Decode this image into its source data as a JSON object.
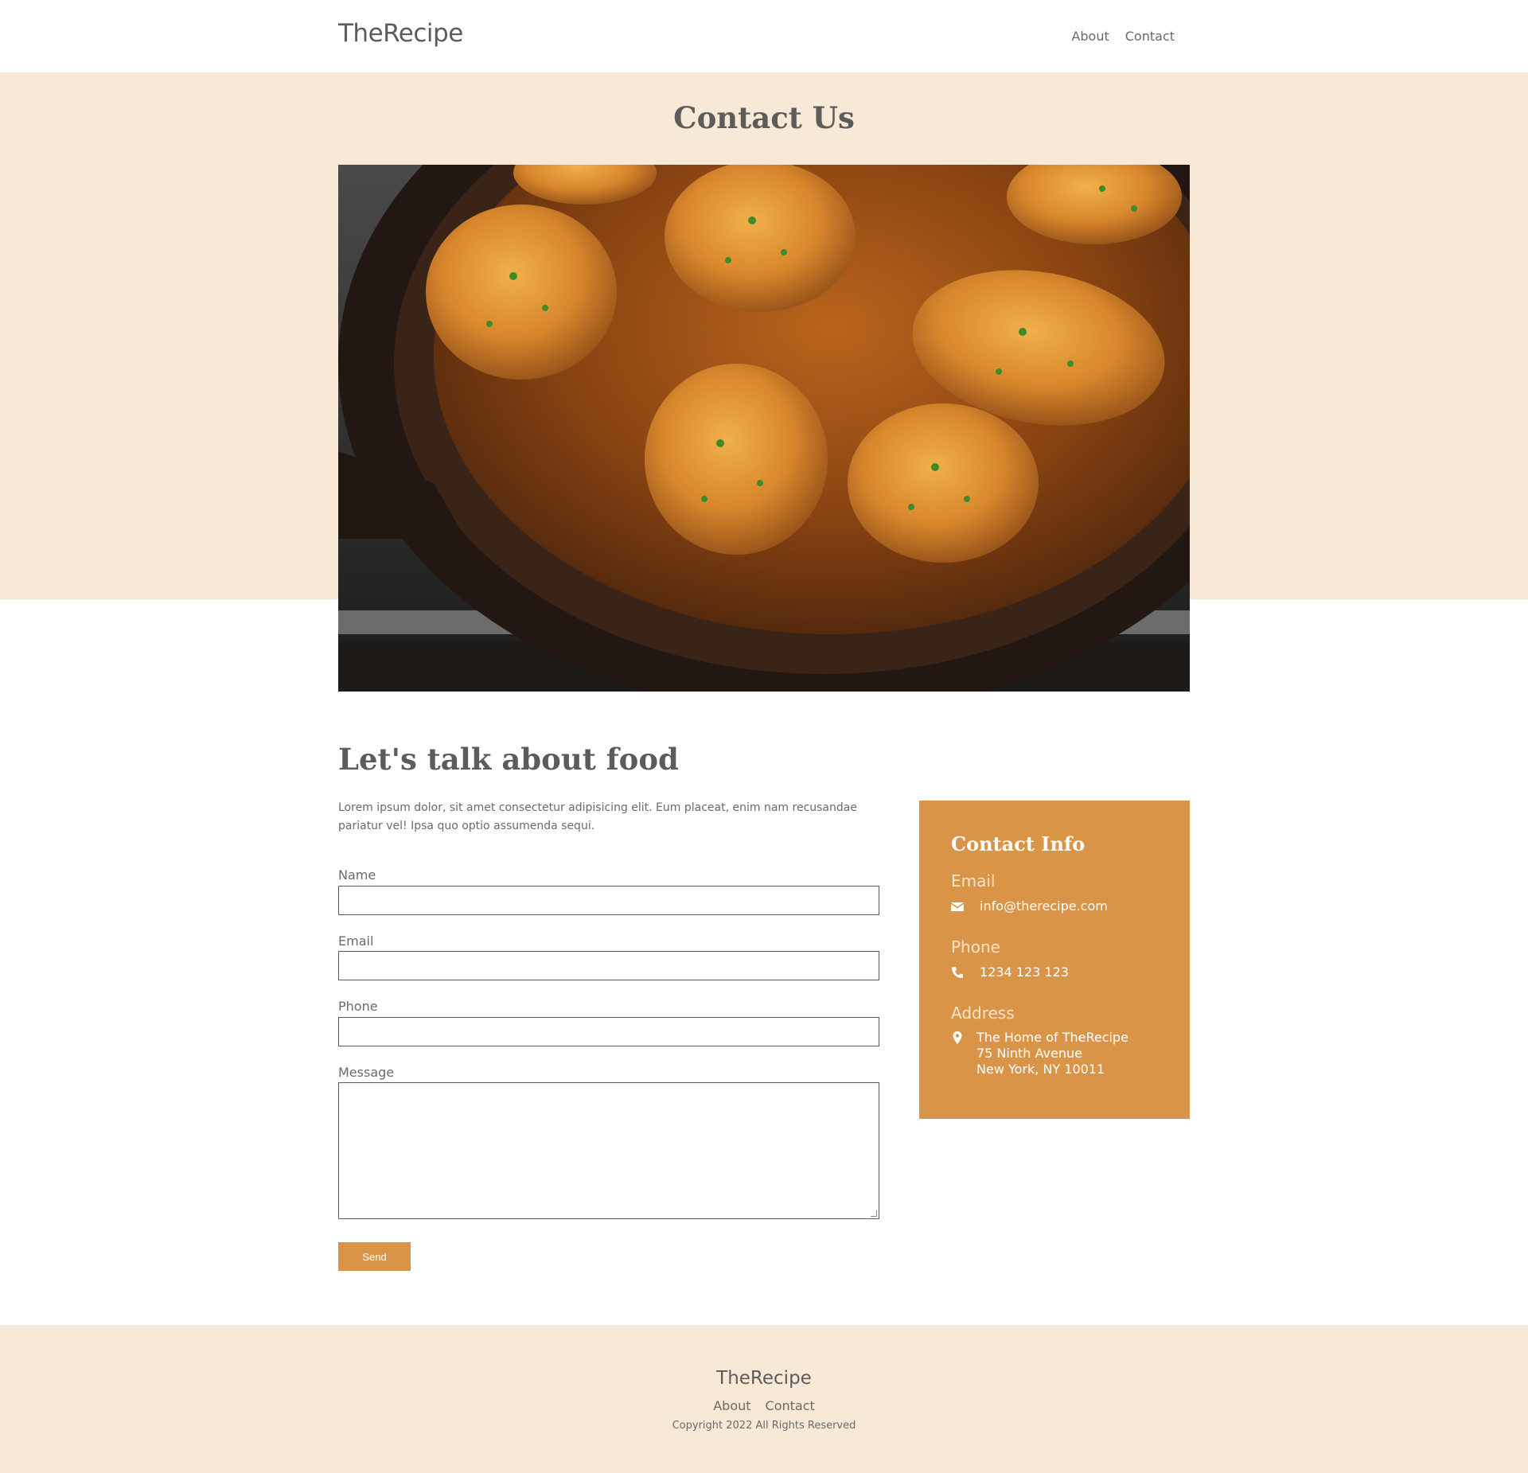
{
  "header": {
    "logo": "TheRecipe",
    "nav": [
      {
        "label": "About"
      },
      {
        "label": "Contact"
      }
    ]
  },
  "hero": {
    "title": "Contact Us",
    "image_alt": "chicken-thighs-in-cast-iron-skillet"
  },
  "content": {
    "heading": "Let's talk about food",
    "intro": "Lorem ipsum dolor, sit amet consectetur adipisicing elit. Eum placeat, enim nam recusandae pariatur vel! Ipsa quo optio assumenda sequi."
  },
  "form": {
    "name_label": "Name",
    "email_label": "Email",
    "phone_label": "Phone",
    "message_label": "Message",
    "name_value": "",
    "email_value": "",
    "phone_value": "",
    "message_value": "",
    "send_label": "Send"
  },
  "contact_info": {
    "title": "Contact Info",
    "email_label": "Email",
    "email": "info@therecipe.com",
    "phone_label": "Phone",
    "phone": "1234 123 123",
    "address_label": "Address",
    "address_lines": [
      "The Home of TheRecipe",
      "75 Ninth Avenue",
      "New York, NY 10011"
    ],
    "icons": {
      "email": "envelope-icon",
      "phone": "phone-icon",
      "address": "map-marker-icon"
    }
  },
  "footer": {
    "logo": "TheRecipe",
    "nav": [
      {
        "label": "About"
      },
      {
        "label": "Contact"
      }
    ],
    "copyright": "Copyright 2022 All Rights Reserved"
  },
  "colors": {
    "accent": "#d99447",
    "cream": "#f8e9d6",
    "text": "#5c5c5c"
  }
}
